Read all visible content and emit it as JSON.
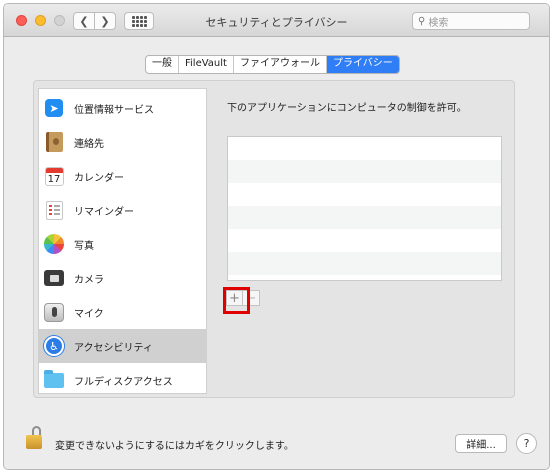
{
  "window": {
    "title": "セキュリティとプライバシー",
    "search_placeholder": "検索"
  },
  "tabs": [
    {
      "label": "一般",
      "active": false
    },
    {
      "label": "FileVault",
      "active": false
    },
    {
      "label": "ファイアウォール",
      "active": false
    },
    {
      "label": "プライバシー",
      "active": true
    }
  ],
  "sidebar": {
    "items": [
      {
        "label": "位置情報サービス",
        "icon": "location-arrow-icon"
      },
      {
        "label": "連絡先",
        "icon": "contacts-book-icon"
      },
      {
        "label": "カレンダー",
        "icon": "calendar-icon",
        "icon_text": "17"
      },
      {
        "label": "リマインダー",
        "icon": "reminders-list-icon"
      },
      {
        "label": "写真",
        "icon": "photos-flower-icon"
      },
      {
        "label": "カメラ",
        "icon": "camera-icon"
      },
      {
        "label": "マイク",
        "icon": "microphone-icon"
      },
      {
        "label": "アクセシビリティ",
        "icon": "accessibility-icon",
        "selected": true
      },
      {
        "label": "フルディスクアクセス",
        "icon": "folder-icon"
      }
    ]
  },
  "main": {
    "description": "下のアプリケーションにコンピュータの制御を許可。",
    "add_label": "+",
    "remove_label": "−"
  },
  "footer": {
    "lock_text": "変更できないようにするにはカギをクリックします。",
    "details_label": "詳細...",
    "help_label": "?"
  },
  "colors": {
    "accent": "#2f7ef5",
    "highlight": "#e00000",
    "selected_row": "#d0d0d0"
  }
}
